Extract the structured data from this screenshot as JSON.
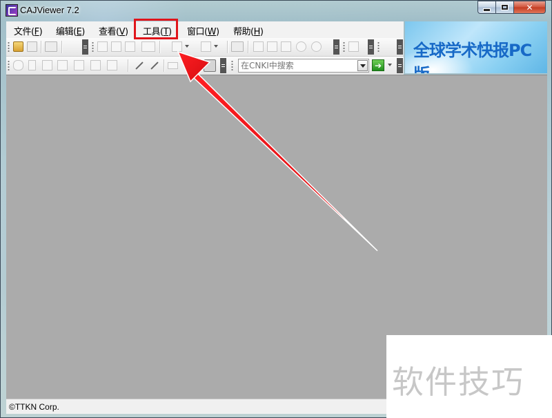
{
  "window": {
    "title": "CAJViewer 7.2",
    "controls": [
      "minimize",
      "maximize",
      "close"
    ]
  },
  "menubar": {
    "items": [
      {
        "label": "文件(F)",
        "pre": "文件(",
        "key": "F",
        "post": ")"
      },
      {
        "label": "编辑(E)",
        "pre": "编辑(",
        "key": "E",
        "post": ")"
      },
      {
        "label": "查看(V)",
        "pre": "查看(",
        "key": "V",
        "post": ")"
      },
      {
        "label": "工具(T)",
        "pre": "工具(",
        "key": "T",
        "post": ")",
        "highlighted": true
      },
      {
        "label": "窗口(W)",
        "pre": "窗口(",
        "key": "W",
        "post": ")"
      },
      {
        "label": "帮助(H)",
        "pre": "帮助(",
        "key": "H",
        "post": ")"
      }
    ]
  },
  "toolbar": {
    "search_placeholder": "在CNKI中搜索",
    "go_icon": "green-arrow-right"
  },
  "banner": {
    "text": "全球学术快报PC版"
  },
  "statusbar": {
    "text": "©TTKN Corp."
  },
  "watermark": {
    "text": "软件技巧"
  },
  "annotation": {
    "highlight_color": "#e0151b",
    "arrow_color": "#e0151b"
  }
}
